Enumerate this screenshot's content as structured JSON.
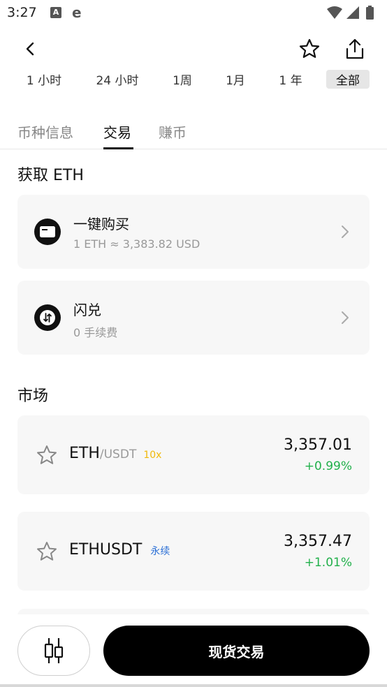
{
  "status_bar": {
    "time": "3:27",
    "icons": [
      "a-app-icon",
      "browser-icon",
      "wifi-icon",
      "signal-icon",
      "battery-icon"
    ]
  },
  "nav": {
    "back_icon": "back-arrow-icon",
    "favorite_icon": "star-outline-icon",
    "share_icon": "share-icon"
  },
  "range_tabs": [
    {
      "label": "1 小时"
    },
    {
      "label": "24 小时"
    },
    {
      "label": "1周"
    },
    {
      "label": "1月"
    },
    {
      "label": "1 年"
    },
    {
      "label": "全部",
      "active": true
    }
  ],
  "main_tabs": [
    {
      "label": "币种信息"
    },
    {
      "label": "交易",
      "active": true
    },
    {
      "label": "赚币"
    }
  ],
  "acquire": {
    "title": "获取 ETH",
    "items": [
      {
        "title": "一键购买",
        "subtitle": "1 ETH ≈ 3,383.82 USD",
        "icon": "card-icon"
      },
      {
        "title": "闪兑",
        "subtitle": "0 手续费",
        "icon": "swap-icon"
      }
    ]
  },
  "market": {
    "title": "市场",
    "items": [
      {
        "base": "ETH",
        "quote": "/USDT",
        "tag": "10x",
        "price": "3,357.01",
        "change": "+0.99%"
      },
      {
        "base": "ETHUSDT",
        "quote": "",
        "tag": "永续",
        "price": "3,357.47",
        "change": "+1.01%"
      }
    ]
  },
  "bottom": {
    "chart_icon": "candlestick-icon",
    "trade_label": "现货交易"
  },
  "colors": {
    "up": "#22b04b",
    "leverage_tag": "#f0b90b",
    "perp_tag": "#2b6fd6",
    "card_bg": "#f7f7f7"
  }
}
